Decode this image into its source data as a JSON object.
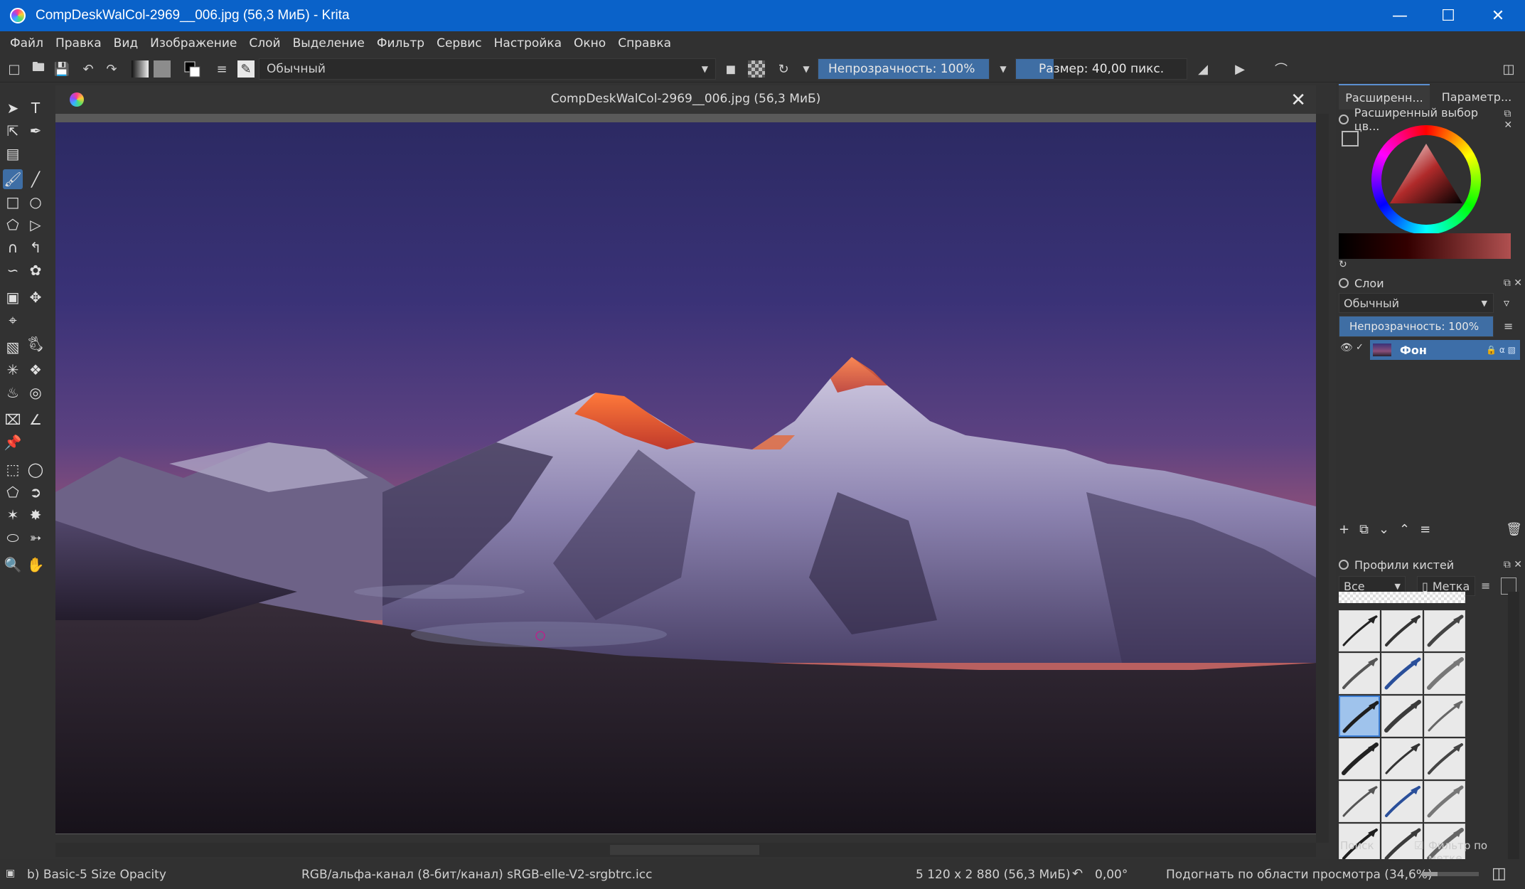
{
  "window": {
    "title": "CompDeskWalCol-2969__006.jpg (56,3 МиБ) - Krita",
    "minimize": "—",
    "maximize": "☐",
    "close": "✕"
  },
  "menu": [
    "Файл",
    "Правка",
    "Вид",
    "Изображение",
    "Слой",
    "Выделение",
    "Фильтр",
    "Сервис",
    "Настройка",
    "Окно",
    "Справка"
  ],
  "tool_options": {
    "blend_mode": "Обычный",
    "opacity_label": "Непрозрачность: 100%",
    "opacity_value": 1.0,
    "size_label": "Размер: 40,00 пикс.",
    "size_fill": 0.22
  },
  "document": {
    "tab_title": "CompDeskWalCol-2969__006.jpg (56,3 МиБ)",
    "close": "✕"
  },
  "right_panel": {
    "tabs": [
      "Расширенн...",
      "Параметр..."
    ],
    "color_docker_title": "Расширенный выбор цв...",
    "layers_title": "Слои",
    "layers_blend": "Обычный",
    "layers_opacity": "Непрозрачность: 100%",
    "layers": [
      {
        "name": "Фон",
        "visible": true,
        "selected": true
      }
    ],
    "brush_title": "Профили кистей",
    "brush_filter": "Все",
    "brush_tag": "Метка",
    "search_label": "Поиск",
    "filter_by_tag": "Фильтр по метке"
  },
  "status": {
    "brush": "b) Basic-5 Size Opacity",
    "color_model": "RGB/альфа-канал (8-бит/канал)  sRGB-elle-V2-srgbtrc.icc",
    "dimensions": "5 120 x 2 880 (56,3 МиБ)",
    "rotation": "0,00°",
    "zoom": "Подогнать по области просмотра (34,6%)"
  },
  "colors": {
    "titlebar": "#0a62c9",
    "accent": "#3e6ea5",
    "panel": "#313131"
  }
}
